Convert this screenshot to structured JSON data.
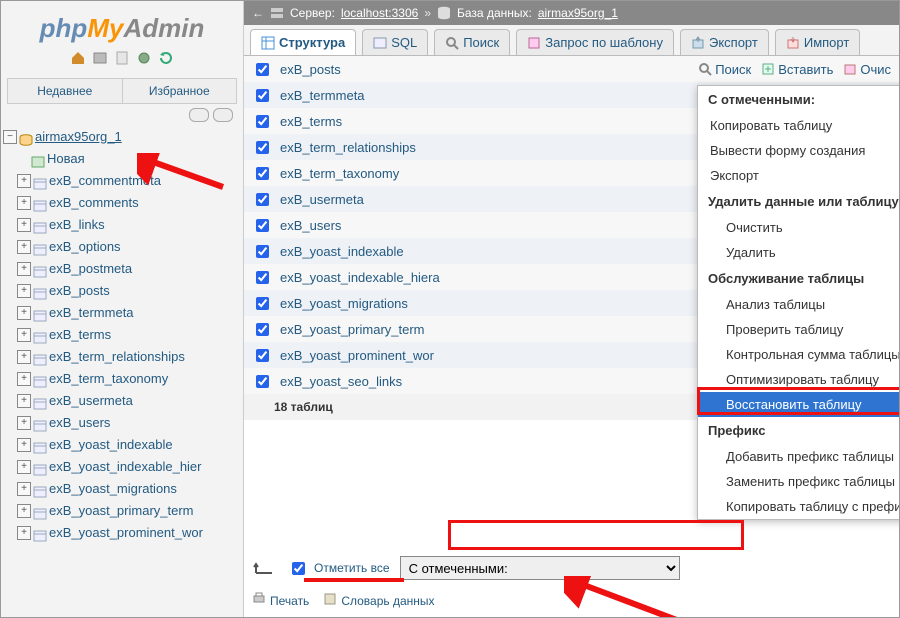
{
  "logo": {
    "p1": "php",
    "p2": "My",
    "p3": "Admin"
  },
  "sidebar": {
    "recent_label": "Недавнее",
    "favorites_label": "Избранное",
    "db_name": "airmax95org_1",
    "new_label": "Новая",
    "tables": [
      "exB_commentmeta",
      "exB_comments",
      "exB_links",
      "exB_options",
      "exB_postmeta",
      "exB_posts",
      "exB_termmeta",
      "exB_terms",
      "exB_term_relationships",
      "exB_term_taxonomy",
      "exB_usermeta",
      "exB_users",
      "exB_yoast_indexable",
      "exB_yoast_indexable_hier",
      "exB_yoast_migrations",
      "exB_yoast_primary_term",
      "exB_yoast_prominent_wor"
    ]
  },
  "breadcrumb": {
    "server_label": "Сервер:",
    "server_value": "localhost:3306",
    "db_label": "База данных:",
    "db_value": "airmax95org_1"
  },
  "tabs": {
    "structure": "Структура",
    "sql": "SQL",
    "search": "Поиск",
    "qbe": "Запрос по шаблону",
    "export": "Экспорт",
    "import": "Импорт"
  },
  "main": {
    "rows": [
      "exB_posts",
      "exB_termmeta",
      "exB_terms",
      "exB_term_relationships",
      "exB_term_taxonomy",
      "exB_usermeta",
      "exB_users",
      "exB_yoast_indexable",
      "exB_yoast_indexable_hiera",
      "exB_yoast_migrations",
      "exB_yoast_primary_term",
      "exB_yoast_prominent_wor",
      "exB_yoast_seo_links"
    ],
    "summary": "18 таблиц",
    "action_search": "Поиск",
    "action_insert": "Вставить",
    "action_clean": "Очис"
  },
  "context_menu": {
    "header": "С отмеченными:",
    "items": [
      {
        "label": "Копировать таблицу",
        "kind": "item"
      },
      {
        "label": "Вывести форму создания",
        "kind": "item"
      },
      {
        "label": "Экспорт",
        "kind": "item"
      },
      {
        "label": "Удалить данные или таблицу",
        "kind": "group"
      },
      {
        "label": "Очистить",
        "kind": "sub"
      },
      {
        "label": "Удалить",
        "kind": "sub"
      },
      {
        "label": "Обслуживание таблицы",
        "kind": "group"
      },
      {
        "label": "Анализ таблицы",
        "kind": "sub"
      },
      {
        "label": "Проверить таблицу",
        "kind": "sub"
      },
      {
        "label": "Контрольная сумма таблицы",
        "kind": "sub"
      },
      {
        "label": "Оптимизировать таблицу",
        "kind": "sub"
      },
      {
        "label": "Восстановить таблицу",
        "kind": "sub",
        "selected": true
      },
      {
        "label": "Префикс",
        "kind": "group"
      },
      {
        "label": "Добавить префикс таблицы",
        "kind": "sub"
      },
      {
        "label": "Заменить префикс таблицы",
        "kind": "sub"
      },
      {
        "label": "Копировать таблицу с префиксом",
        "kind": "sub"
      }
    ]
  },
  "footer": {
    "check_all": "Отметить все",
    "with_selected": "С отмеченными:",
    "print": "Печать",
    "dictionary": "Словарь данных"
  },
  "colors": {
    "accent": "#2f74d0",
    "red": "#e11"
  }
}
